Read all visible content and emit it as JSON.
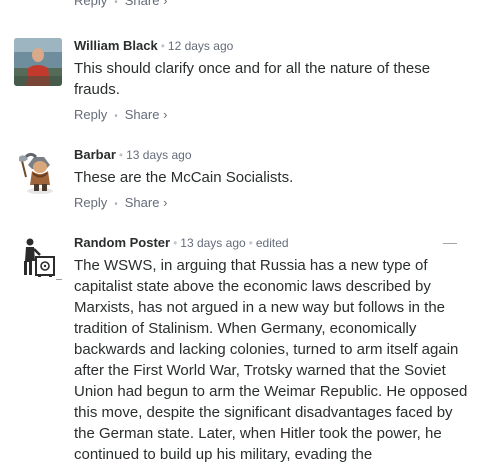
{
  "comments": [
    {
      "author": "",
      "time": "",
      "text": "",
      "reply": "Reply",
      "share": "Share ›"
    },
    {
      "author": "William Black",
      "time": "12 days ago",
      "text": "This should clarify once and for all the nature of these frauds.",
      "reply": "Reply",
      "share": "Share ›"
    },
    {
      "author": "Barbar",
      "time": "13 days ago",
      "text": "These are the McCain Socialists.",
      "reply": "Reply",
      "share": "Share ›"
    },
    {
      "author": "Random Poster",
      "time": "13 days ago",
      "edited": "edited",
      "collapse": "—",
      "text": "The WSWS, in arguing that Russia has a new type of capitalist state above the economic laws described by Marxists, has not argued in a new way but follows in the tradition of Stalinism. When Germany, economically backwards and lacking colonies, turned to arm itself again after the First World War, Trotsky warned that the Soviet Union had begun to arm the Weimar Republic. He opposed this move, despite the significant disadvantages faced by the German state. Later, when Hitler took the power, he continued to build up his military, evading the"
    }
  ],
  "icons": {
    "avatar_1": "photo-avatar",
    "avatar_2": "barbarian-avatar",
    "avatar_3": "person-with-safe-avatar"
  }
}
